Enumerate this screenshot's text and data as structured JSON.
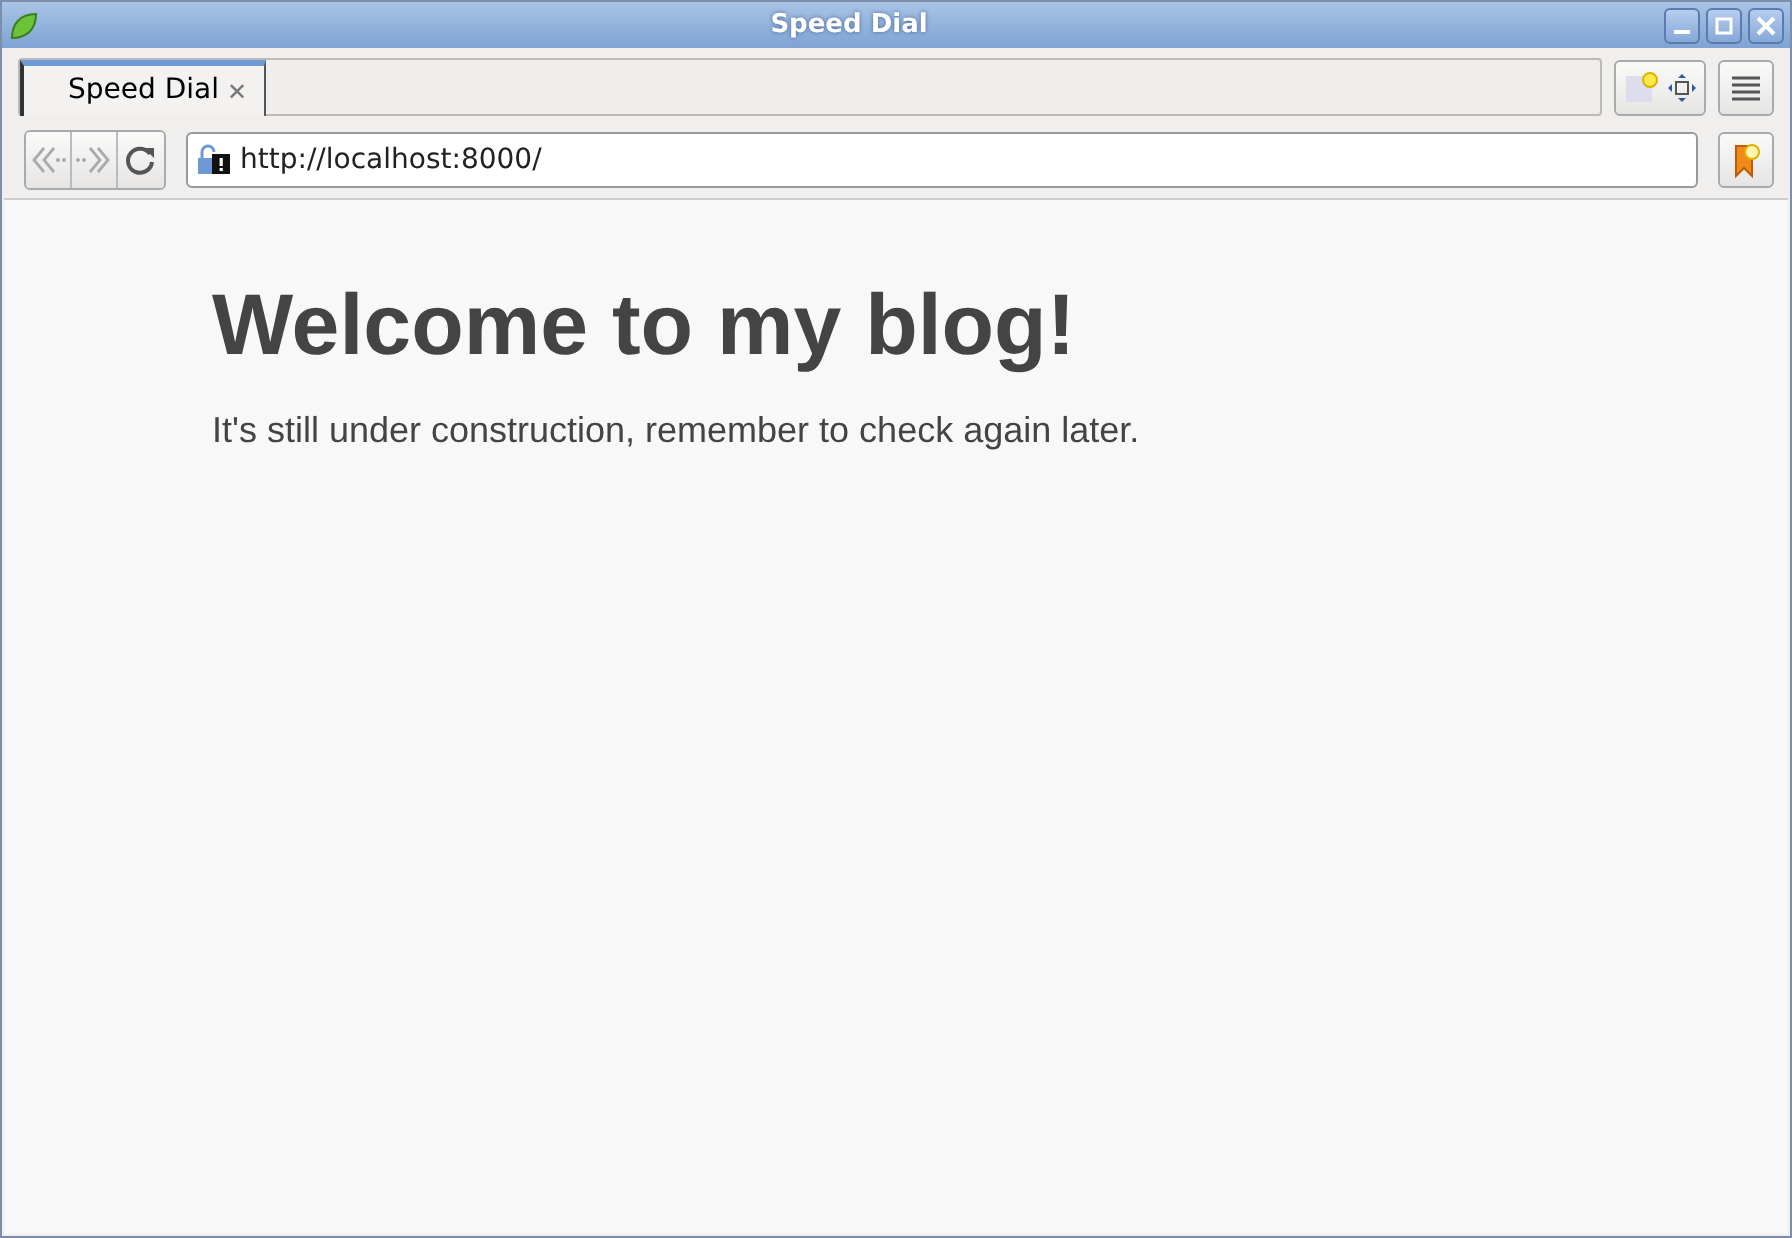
{
  "window": {
    "title": "Speed Dial"
  },
  "tabs": [
    {
      "label": "Speed Dial",
      "selected": true,
      "close": "✕"
    }
  ],
  "nav_buttons": [
    {
      "kind": "back",
      "disabled": true
    },
    {
      "kind": "forward",
      "disabled": true
    },
    {
      "kind": "reload",
      "disabled": false
    }
  ],
  "address": {
    "url": "http://localhost:8000/"
  },
  "page": {
    "heading": "Welcome to my blog!",
    "text": "It's still under construction, remember to check again later."
  }
}
